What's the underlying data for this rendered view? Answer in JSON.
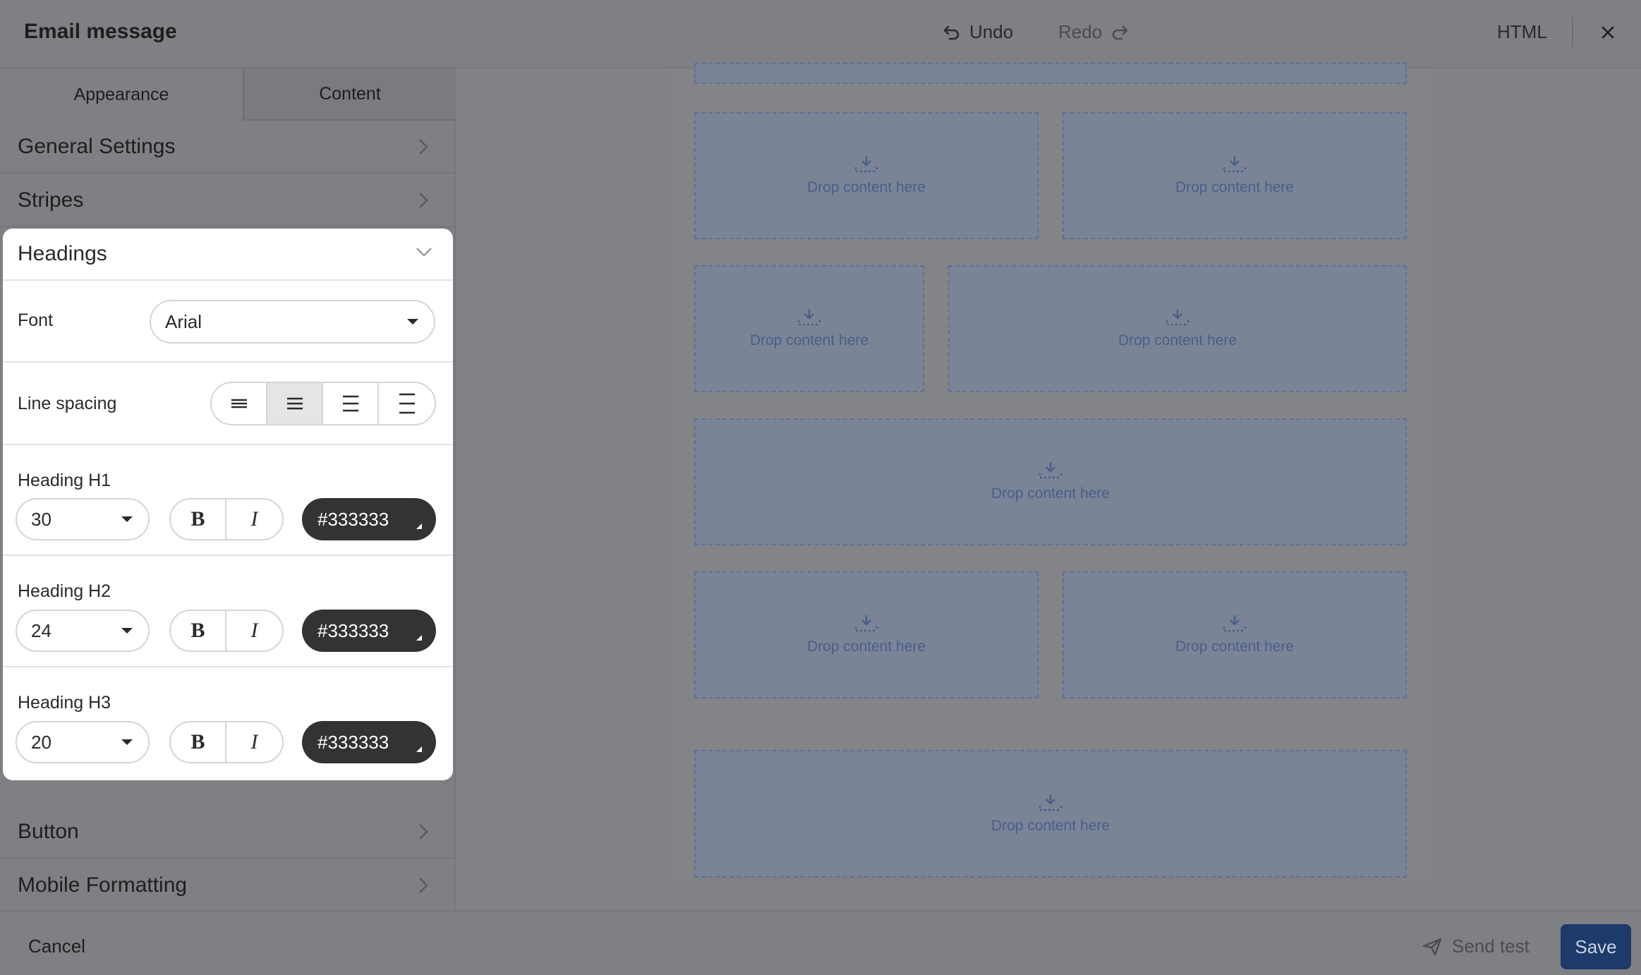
{
  "header": {
    "title": "Email message",
    "undo_label": "Undo",
    "redo_label": "Redo",
    "html_label": "HTML"
  },
  "tabs": [
    {
      "label": "Appearance"
    },
    {
      "label": "Content"
    }
  ],
  "sections": {
    "general_settings": "General Settings",
    "stripes": "Stripes",
    "headings": "Headings",
    "button": "Button",
    "mobile_formatting": "Mobile Formatting"
  },
  "headings_panel": {
    "font_label": "Font",
    "font_value": "Arial",
    "line_spacing_label": "Line spacing",
    "line_spacing_selected": 2,
    "h1": {
      "label": "Heading H1",
      "size": "30",
      "color": "#333333"
    },
    "h2": {
      "label": "Heading H2",
      "size": "24",
      "color": "#333333"
    },
    "h3": {
      "label": "Heading H3",
      "size": "20",
      "color": "#333333"
    },
    "bold_label": "B",
    "italic_label": "I"
  },
  "canvas": {
    "drop_label": "Drop content here",
    "drop_zone_count": 9
  },
  "footer": {
    "cancel_label": "Cancel",
    "send_test_label": "Send test",
    "save_label": "Save"
  },
  "colors": {
    "save_button": "#1d3a6b",
    "color_swatch": "#333333",
    "overlay": "#808285"
  }
}
